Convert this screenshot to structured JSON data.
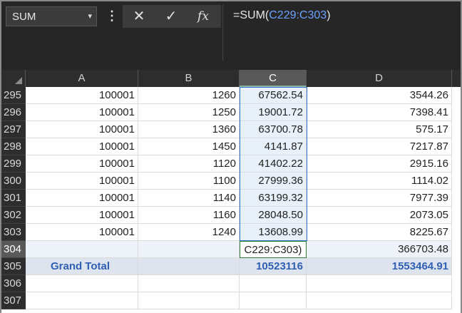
{
  "name_box": {
    "value": "SUM",
    "arrow": "▾"
  },
  "formula_bar": {
    "dots": "⋮",
    "cancel": "✕",
    "enter": "✓",
    "fx": "fx",
    "formula_prefix": "=SUM(",
    "formula_ref": "C229:C303",
    "formula_suffix": ")"
  },
  "columns": [
    "A",
    "B",
    "C",
    "D"
  ],
  "rows": [
    {
      "num": "295",
      "A": "100001",
      "B": "1260",
      "C": "67562.54",
      "D": "3544.26"
    },
    {
      "num": "296",
      "A": "100001",
      "B": "1250",
      "C": "19001.72",
      "D": "7398.41"
    },
    {
      "num": "297",
      "A": "100001",
      "B": "1360",
      "C": "63700.78",
      "D": "575.17"
    },
    {
      "num": "298",
      "A": "100001",
      "B": "1450",
      "C": "4141.87",
      "D": "7217.87"
    },
    {
      "num": "299",
      "A": "100001",
      "B": "1120",
      "C": "41402.22",
      "D": "2915.16"
    },
    {
      "num": "300",
      "A": "100001",
      "B": "1100",
      "C": "27999.36",
      "D": "1114.02"
    },
    {
      "num": "301",
      "A": "100001",
      "B": "1140",
      "C": "63199.32",
      "D": "7977.39"
    },
    {
      "num": "302",
      "A": "100001",
      "B": "1160",
      "C": "28048.50",
      "D": "2073.05"
    },
    {
      "num": "303",
      "A": "100001",
      "B": "1240",
      "C": "13608.99",
      "D": "8225.67"
    }
  ],
  "row304": {
    "num": "304",
    "C_edit": "C229:C303)",
    "D": "366703.48"
  },
  "row305": {
    "num": "305",
    "label": "Grand Total",
    "C": "10523116",
    "D": "1553464.91"
  },
  "empty_rows": [
    "306",
    "307"
  ],
  "colors": {
    "accent": "#2e75c9",
    "total_text": "#2f5fb3",
    "edit_border": "#2e7d32"
  }
}
